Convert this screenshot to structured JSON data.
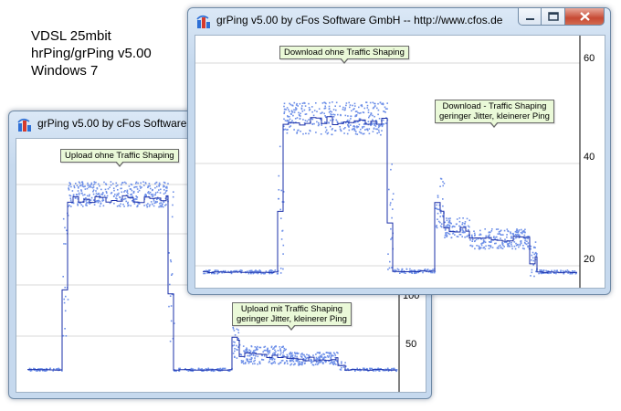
{
  "caption": {
    "line1": "VDSL 25mbit",
    "line2": "hrPing/grPing v5.00",
    "line3": "Windows 7"
  },
  "back_window": {
    "title": "grPing v5.00 by cFos Software GmbH -- http://www.cfos.de",
    "annotations": {
      "upload_no_shaping": "Upload ohne Traffic Shaping",
      "upload_shaping_1": "Upload mit Traffic Shaping",
      "upload_shaping_2": "geringer Jitter, kleinerer Ping"
    },
    "axis": {
      "label_50": "50",
      "label_100": "100"
    }
  },
  "front_window": {
    "title": "grPing v5.00 by cFos Software GmbH -- http://www.cfos.de",
    "annotations": {
      "download_no_shaping": "Download ohne Traffic Shaping",
      "download_shaping_1": "Download - Traffic Shaping",
      "download_shaping_2": "geringer Jitter, kleinerer Ping"
    },
    "axis": {
      "label_60": "60",
      "label_40": "40",
      "label_20": "20"
    }
  },
  "icons": {
    "app": "grping-app-icon",
    "minimize": "minimize-icon",
    "maximize": "maximize-icon",
    "close": "close-icon"
  },
  "colors": {
    "points": "#6d8fe8",
    "line": "#1a2fa8",
    "gridline": "#d9d9d9"
  }
}
